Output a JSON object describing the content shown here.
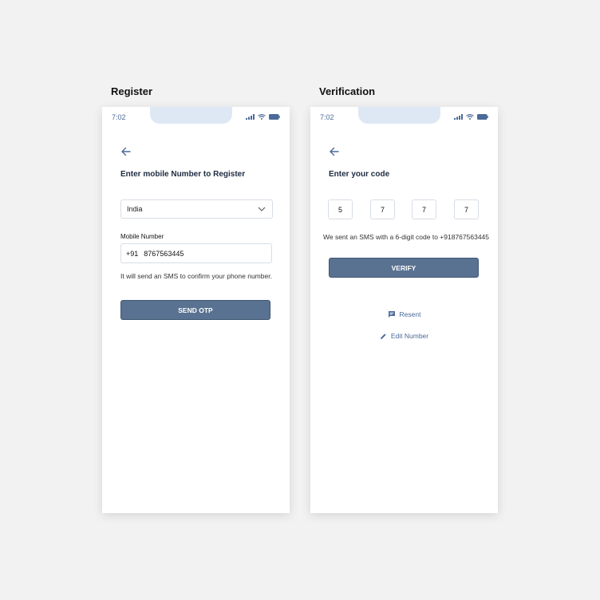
{
  "register": {
    "screen_title": "Register",
    "status_time": "7:02",
    "heading": "Enter mobile Number to Register",
    "country_select": {
      "value": "India"
    },
    "mobile_label": "Mobile Number",
    "country_code": "+91",
    "phone_value": "8767563445",
    "helper_text": "It will send an SMS to confirm your phone number.",
    "send_button": "SEND OTP"
  },
  "verification": {
    "screen_title": "Verification",
    "status_time": "7:02",
    "heading": "Enter your code",
    "code_digits": [
      "5",
      "7",
      "7",
      "7"
    ],
    "sms_note": "We sent an SMS with a 6-digit code to +918767563445",
    "verify_button": "VERIFY",
    "resent_link": "Resent",
    "edit_link": "Edit Number"
  },
  "colors": {
    "accent": "#5a7291",
    "link": "#4a6a99",
    "notch": "#dde8f4",
    "background": "#f2f2f2"
  },
  "icons": [
    "back-arrow-icon",
    "chevron-down-icon",
    "signal-icon",
    "wifi-icon",
    "battery-icon",
    "message-icon",
    "pencil-icon"
  ]
}
